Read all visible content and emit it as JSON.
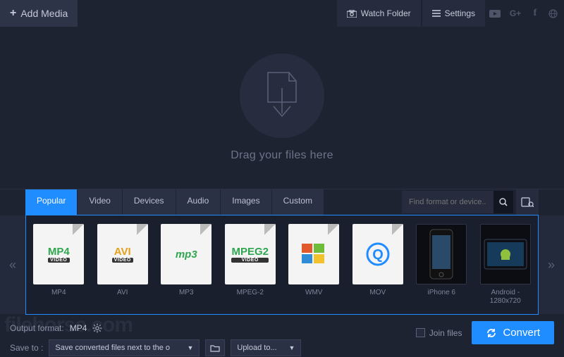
{
  "topbar": {
    "add_media": "Add Media",
    "watch_folder": "Watch Folder",
    "settings": "Settings"
  },
  "dropzone": {
    "text": "Drag your files here"
  },
  "tabs": [
    "Popular",
    "Video",
    "Devices",
    "Audio",
    "Images",
    "Custom"
  ],
  "active_tab": 0,
  "search": {
    "placeholder": "Find format or device..."
  },
  "presets": [
    {
      "name": "MP4",
      "badge": "MP4",
      "sub": "VIDEO",
      "color": "#2fa64f",
      "type": "file"
    },
    {
      "name": "AVI",
      "badge": "AVI",
      "sub": "VIDEO",
      "color": "#e6a11a",
      "type": "file"
    },
    {
      "name": "MP3",
      "badge": "mp3",
      "sub": "",
      "color": "#2fa64f",
      "type": "file"
    },
    {
      "name": "MPEG-2",
      "badge": "MPEG2",
      "sub": "VIDEO",
      "color": "#2fa64f",
      "type": "file"
    },
    {
      "name": "WMV",
      "badge": "win",
      "sub": "",
      "color": "",
      "type": "win"
    },
    {
      "name": "MOV",
      "badge": "Q",
      "sub": "",
      "color": "#1f8cff",
      "type": "q"
    },
    {
      "name": "iPhone 6",
      "badge": "",
      "sub": "",
      "color": "",
      "type": "iphone"
    },
    {
      "name": "Android - 1280x720",
      "badge": "",
      "sub": "",
      "color": "",
      "type": "android"
    }
  ],
  "output": {
    "label": "Output format:",
    "value": "MP4"
  },
  "save": {
    "label": "Save to :",
    "path": "Save converted files next to the o",
    "upload": "Upload to..."
  },
  "footer": {
    "join": "Join files",
    "convert": "Convert"
  },
  "watermark": "filehorse.com"
}
